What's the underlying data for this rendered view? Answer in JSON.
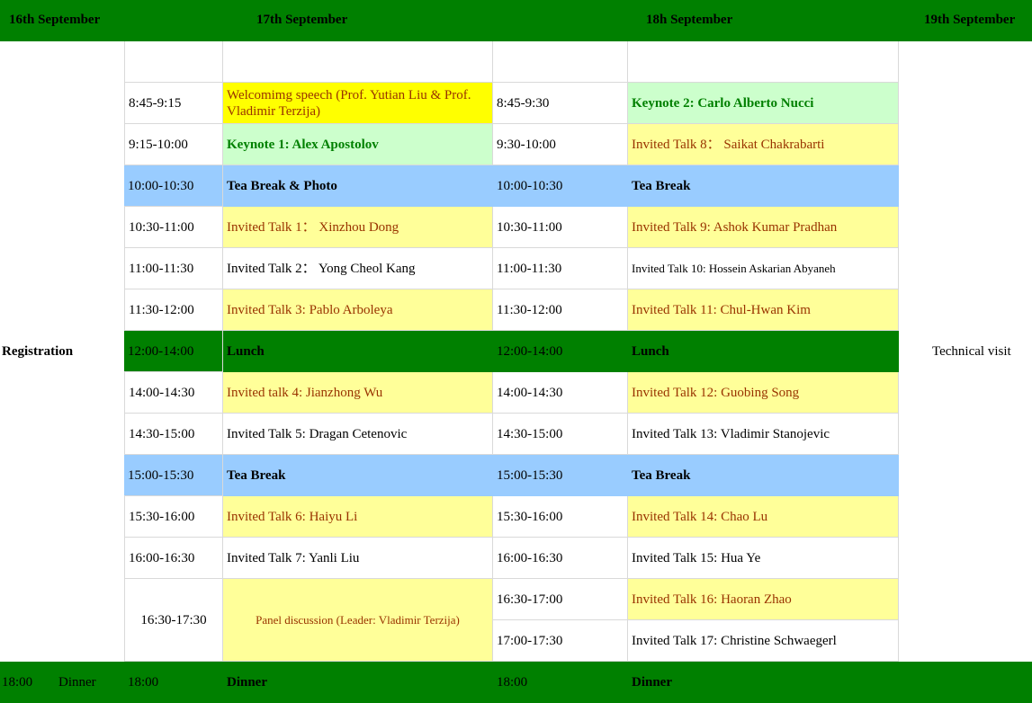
{
  "colors": {
    "header_green": "#008000",
    "keynote_green_bg": "#ccffcc",
    "keynote_green_text": "#008000",
    "invited_yellow_bg": "#ffff99",
    "invited_text": "#993300",
    "welcome_yellow_bg": "#ffff00",
    "tea_blue_bg": "#99ccff"
  },
  "headers": {
    "day1": "16th September",
    "day2": "17th September",
    "day3": "18h September",
    "day4": "19th September"
  },
  "day1": {
    "registration": "Registration",
    "dinner_time": "18:00",
    "dinner_label": "Dinner"
  },
  "day4": {
    "technical_visit": "Technical visit"
  },
  "day2": {
    "rows": [
      {
        "time": "8:45-9:15",
        "event": "Welcomimg speech (Prof. Yutian Liu & Prof. Vladimir Terzija)"
      },
      {
        "time": "9:15-10:00",
        "event": "Keynote 1: Alex Apostolov"
      },
      {
        "time": "10:00-10:30",
        "event": "Tea Break & Photo"
      },
      {
        "time": "10:30-11:00",
        "event": "Invited Talk 1： Xinzhou Dong"
      },
      {
        "time": "11:00-11:30",
        "event": "Invited Talk 2： Yong Cheol Kang"
      },
      {
        "time": "11:30-12:00",
        "event": "Invited Talk 3: Pablo Arboleya"
      },
      {
        "time": "12:00-14:00",
        "event": "Lunch"
      },
      {
        "time": "14:00-14:30",
        "event": "Invited talk 4: Jianzhong Wu"
      },
      {
        "time": "14:30-15:00",
        "event": "Invited Talk 5: Dragan Cetenovic"
      },
      {
        "time": "15:00-15:30",
        "event": "Tea Break"
      },
      {
        "time": "15:30-16:00",
        "event": "Invited Talk 6: Haiyu Li"
      },
      {
        "time": "16:00-16:30",
        "event": "Invited Talk 7: Yanli Liu"
      },
      {
        "time": "16:30-17:30",
        "event": "Panel discussion (Leader: Vladimir Terzija)"
      },
      {
        "time": "18:00",
        "event": "Dinner"
      }
    ]
  },
  "day3": {
    "rows": [
      {
        "time": "8:45-9:30",
        "event": "Keynote 2: Carlo Alberto Nucci"
      },
      {
        "time": "9:30-10:00",
        "event": "Invited Talk 8： Saikat Chakrabarti"
      },
      {
        "time": "10:00-10:30",
        "event": "Tea Break"
      },
      {
        "time": "10:30-11:00",
        "event": "Invited Talk 9: Ashok Kumar Pradhan"
      },
      {
        "time": "11:00-11:30",
        "event": "Invited Talk 10: Hossein Askarian Abyaneh"
      },
      {
        "time": "11:30-12:00",
        "event": "Invited Talk 11: Chul-Hwan Kim"
      },
      {
        "time": "12:00-14:00",
        "event": "Lunch"
      },
      {
        "time": "14:00-14:30",
        "event": "Invited Talk 12:  Guobing Song"
      },
      {
        "time": "14:30-15:00",
        "event": "Invited Talk 13: Vladimir Stanojevic"
      },
      {
        "time": "15:00-15:30",
        "event": "Tea Break"
      },
      {
        "time": "15:30-16:00",
        "event": "Invited Talk 14: Chao Lu"
      },
      {
        "time": "16:00-16:30",
        "event": "Invited Talk 15: Hua Ye"
      },
      {
        "time": "16:30-17:00",
        "event": "Invited Talk 16: Haoran Zhao"
      },
      {
        "time": "17:00-17:30",
        "event": "Invited Talk 17:  Christine Schwaegerl"
      },
      {
        "time": "18:00",
        "event": "Dinner"
      }
    ]
  }
}
